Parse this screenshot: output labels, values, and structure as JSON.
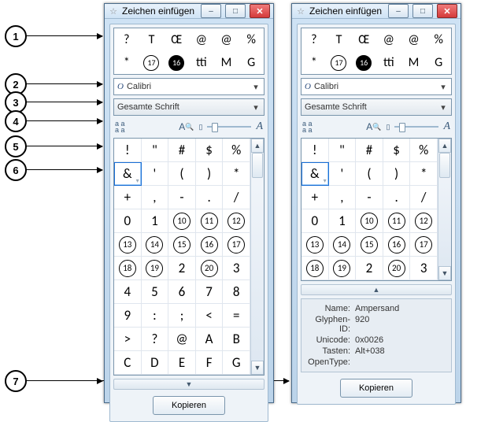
{
  "window": {
    "title": "Zeichen einfügen",
    "min_label": "–",
    "max_label": "□",
    "close_label": "✕",
    "star": "☆"
  },
  "font_combo": {
    "icon": "O",
    "value": "Calibri"
  },
  "subset_combo": {
    "value": "Gesamte Schrift"
  },
  "toolbar": {
    "aa": "a a\na͟ a͟",
    "search": "🔍",
    "bigA": "A"
  },
  "recent_glyphs": [
    {
      "kind": "txt",
      "v": "?"
    },
    {
      "kind": "txt",
      "v": "T"
    },
    {
      "kind": "txt",
      "v": "Œ"
    },
    {
      "kind": "txt",
      "v": "@"
    },
    {
      "kind": "txt",
      "v": "@"
    },
    {
      "kind": "txt",
      "v": "%"
    },
    {
      "kind": "txt",
      "v": "*"
    },
    {
      "kind": "circ",
      "v": "17"
    },
    {
      "kind": "circf",
      "v": "16"
    },
    {
      "kind": "txt",
      "v": "tti"
    },
    {
      "kind": "txt",
      "v": "M"
    },
    {
      "kind": "txt",
      "v": "G"
    }
  ],
  "glyph_grid_full": [
    [
      {
        "v": "!"
      },
      {
        "v": "\""
      },
      {
        "v": "#"
      },
      {
        "v": "$"
      },
      {
        "v": "%"
      }
    ],
    [
      {
        "v": "&",
        "sel": true,
        "alt": true
      },
      {
        "v": "'"
      },
      {
        "v": "("
      },
      {
        "v": ")"
      },
      {
        "v": "*"
      }
    ],
    [
      {
        "v": "+"
      },
      {
        "v": ","
      },
      {
        "v": "-"
      },
      {
        "v": "."
      },
      {
        "v": "/"
      }
    ],
    [
      {
        "v": "0"
      },
      {
        "v": "1"
      },
      {
        "kind": "circ",
        "v": "10"
      },
      {
        "kind": "circ",
        "v": "11"
      },
      {
        "kind": "circ",
        "v": "12"
      }
    ],
    [
      {
        "kind": "circ",
        "v": "13"
      },
      {
        "kind": "circ",
        "v": "14"
      },
      {
        "kind": "circ",
        "v": "15"
      },
      {
        "kind": "circ",
        "v": "16"
      },
      {
        "kind": "circ",
        "v": "17"
      }
    ],
    [
      {
        "kind": "circ",
        "v": "18"
      },
      {
        "kind": "circ",
        "v": "19"
      },
      {
        "v": "2"
      },
      {
        "kind": "circ",
        "v": "20"
      },
      {
        "v": "3"
      }
    ],
    [
      {
        "v": "4"
      },
      {
        "v": "5"
      },
      {
        "v": "6"
      },
      {
        "v": "7"
      },
      {
        "v": "8"
      }
    ],
    [
      {
        "v": "9"
      },
      {
        "v": ":"
      },
      {
        "v": ";"
      },
      {
        "v": "<"
      },
      {
        "v": "="
      }
    ],
    [
      {
        "v": ">"
      },
      {
        "v": "?"
      },
      {
        "v": "@"
      },
      {
        "v": "A"
      },
      {
        "v": "B"
      }
    ],
    [
      {
        "v": "C"
      },
      {
        "v": "D"
      },
      {
        "v": "E"
      },
      {
        "v": "F"
      },
      {
        "v": "G"
      }
    ]
  ],
  "glyph_grid_short": [
    [
      {
        "v": "!"
      },
      {
        "v": "\""
      },
      {
        "v": "#"
      },
      {
        "v": "$"
      },
      {
        "v": "%"
      }
    ],
    [
      {
        "v": "&",
        "sel": true,
        "alt": true
      },
      {
        "v": "'"
      },
      {
        "v": "("
      },
      {
        "v": ")"
      },
      {
        "v": "*"
      }
    ],
    [
      {
        "v": "+"
      },
      {
        "v": ","
      },
      {
        "v": "-"
      },
      {
        "v": "."
      },
      {
        "v": "/"
      }
    ],
    [
      {
        "v": "0"
      },
      {
        "v": "1"
      },
      {
        "kind": "circ",
        "v": "10"
      },
      {
        "kind": "circ",
        "v": "11"
      },
      {
        "kind": "circ",
        "v": "12"
      }
    ],
    [
      {
        "kind": "circ",
        "v": "13"
      },
      {
        "kind": "circ",
        "v": "14"
      },
      {
        "kind": "circ",
        "v": "15"
      },
      {
        "kind": "circ",
        "v": "16"
      },
      {
        "kind": "circ",
        "v": "17"
      }
    ],
    [
      {
        "kind": "circ",
        "v": "18"
      },
      {
        "kind": "circ",
        "v": "19"
      },
      {
        "v": "2"
      },
      {
        "kind": "circ",
        "v": "20"
      },
      {
        "v": "3"
      }
    ]
  ],
  "info_bar": {
    "collapsed": "▼",
    "expanding": "▲"
  },
  "info_panel": {
    "k_name": "Name:",
    "v_name": "Ampersand",
    "k_gid": "Glyphen-ID:",
    "v_gid": "920",
    "k_uni": "Unicode:",
    "v_uni": "0x0026",
    "k_key": "Tasten:",
    "v_key": "Alt+038",
    "k_ot": "OpenType:",
    "v_ot": ""
  },
  "copy_button": "Kopieren",
  "callouts": {
    "1": "1",
    "2": "2",
    "3": "3",
    "4": "4",
    "5": "5",
    "6": "6",
    "7": "7"
  }
}
